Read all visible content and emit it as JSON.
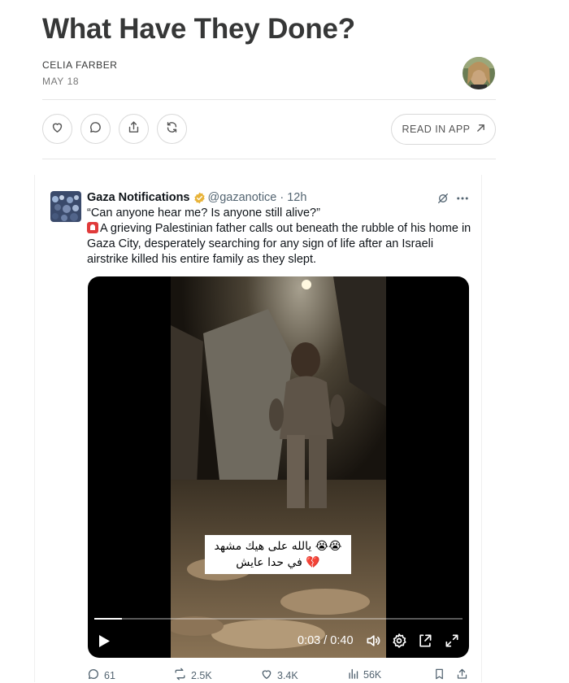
{
  "post": {
    "title": "What Have They Done?",
    "author": "CELIA FARBER",
    "date": "MAY 18",
    "read_in_app": "READ IN APP"
  },
  "tweet": {
    "name": "Gaza Notifications",
    "handle": "@gazanotice",
    "separator": "·",
    "time": "12h",
    "line1": "“Can anyone hear me? Is anyone still alive?”",
    "line2": "A grieving Palestinian father calls out beneath the rubble of his home in Gaza City, desperately searching for any sign of life after an Israeli airstrike killed his entire family as they slept.",
    "video": {
      "caption_line1": "يالله على هيك مشهد 😭😭",
      "caption_line2": "في حدا عايش 💔",
      "timecode": "0:03 / 0:40",
      "progress": 0.075
    },
    "stats": {
      "replies": "61",
      "reposts": "2.5K",
      "likes": "3.4K",
      "views": "56K"
    }
  },
  "colors": {
    "accent_gray": "#536471",
    "verified": "#e8b339",
    "title": "#363737"
  }
}
